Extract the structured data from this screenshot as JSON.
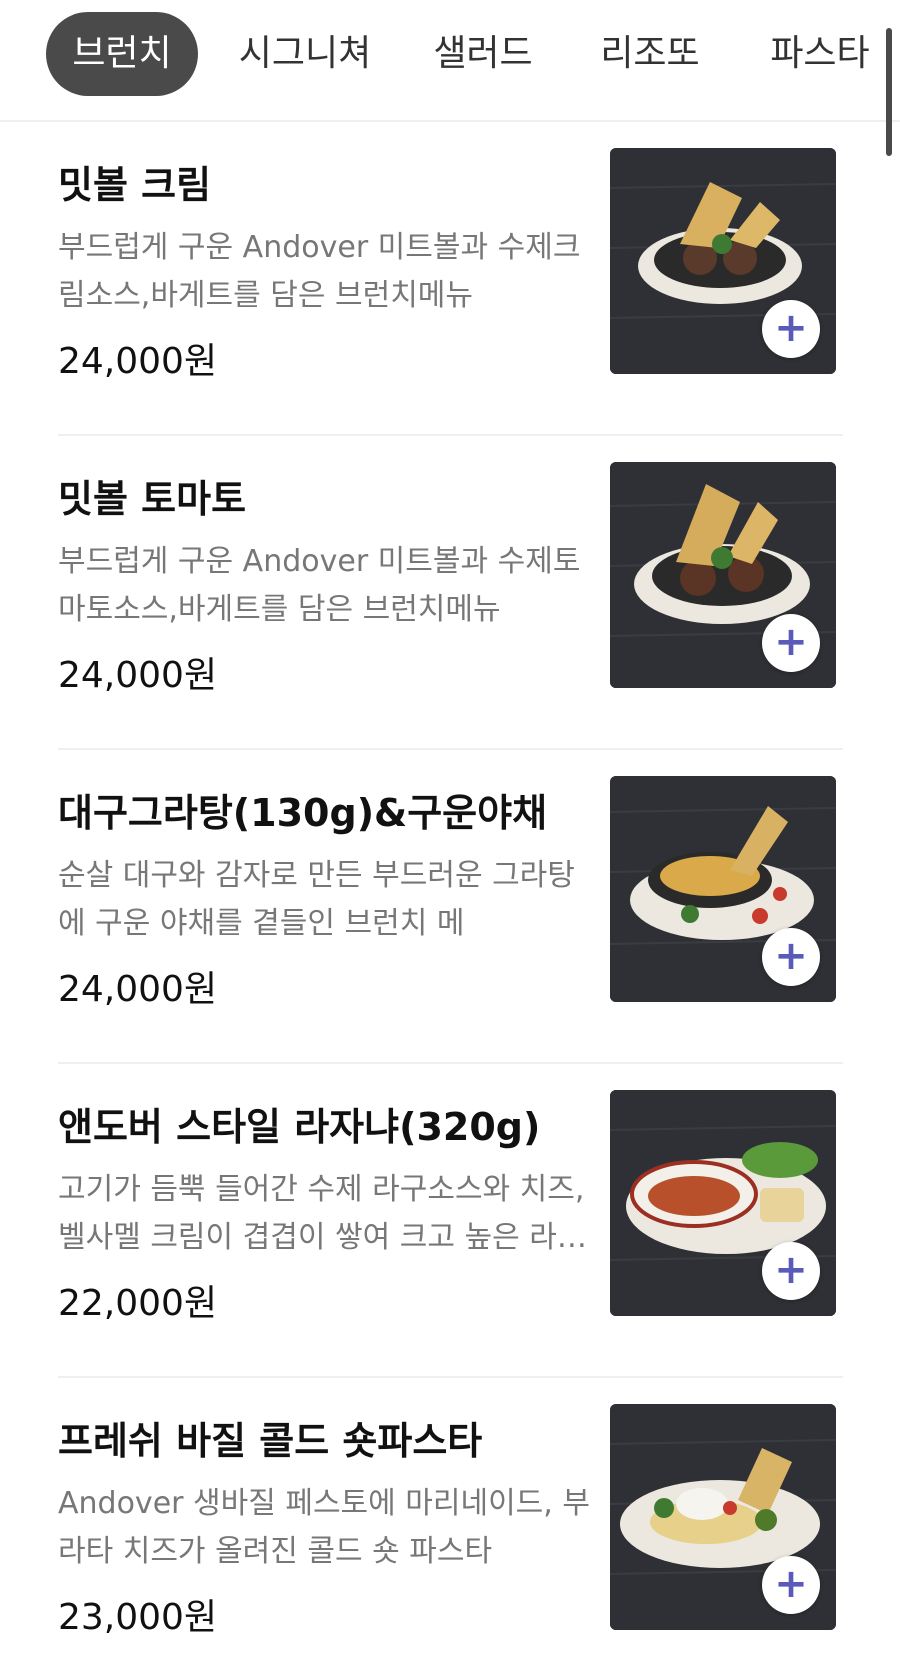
{
  "tabs": [
    {
      "label": "브런치",
      "active": true
    },
    {
      "label": "시그니쳐",
      "active": false
    },
    {
      "label": "샐러드",
      "active": false
    },
    {
      "label": "리조또",
      "active": false
    },
    {
      "label": "파스타",
      "active": false
    }
  ],
  "add_symbol": "+",
  "menu": [
    {
      "name": "밋볼 크림",
      "desc": "부드럽게 구운 Andover 미트볼과 수제크림소스,바게트를 담은 브런치메뉴",
      "price": "24,000원",
      "image_icon": "meatball-cream-dish"
    },
    {
      "name": "밋볼 토마토",
      "desc": "부드럽게 구운 Andover 미트볼과 수제토마토소스,바게트를 담은 브런치메뉴",
      "price": "24,000원",
      "image_icon": "meatball-tomato-dish"
    },
    {
      "name": "대구그라탕(130g)&구운야채",
      "desc": "순살 대구와 감자로 만든 부드러운 그라탕에 구운 야채를 곁들인 브런치 메",
      "price": "24,000원",
      "image_icon": "cod-gratin-dish"
    },
    {
      "name": "앤도버 스타일 라자냐(320g)",
      "desc": "고기가 듬뿍 들어간 수제 라구소스와 치즈, 벨사멜 크림이 겹겹이 쌓여 크고 높은 라자냐",
      "price": "22,000원",
      "image_icon": "lasagna-dish"
    },
    {
      "name": "프레쉬 바질 콜드 숏파스타",
      "desc": "Andover 생바질 페스토에 마리네이드, 부라타 치즈가 올려진 콜드 숏 파스타",
      "price": "23,000원",
      "image_icon": "basil-pasta-dish"
    }
  ],
  "colors": {
    "active_tab_bg": "#4a4a4a",
    "add_icon": "#5a5ab8",
    "desc_text": "#777777"
  }
}
